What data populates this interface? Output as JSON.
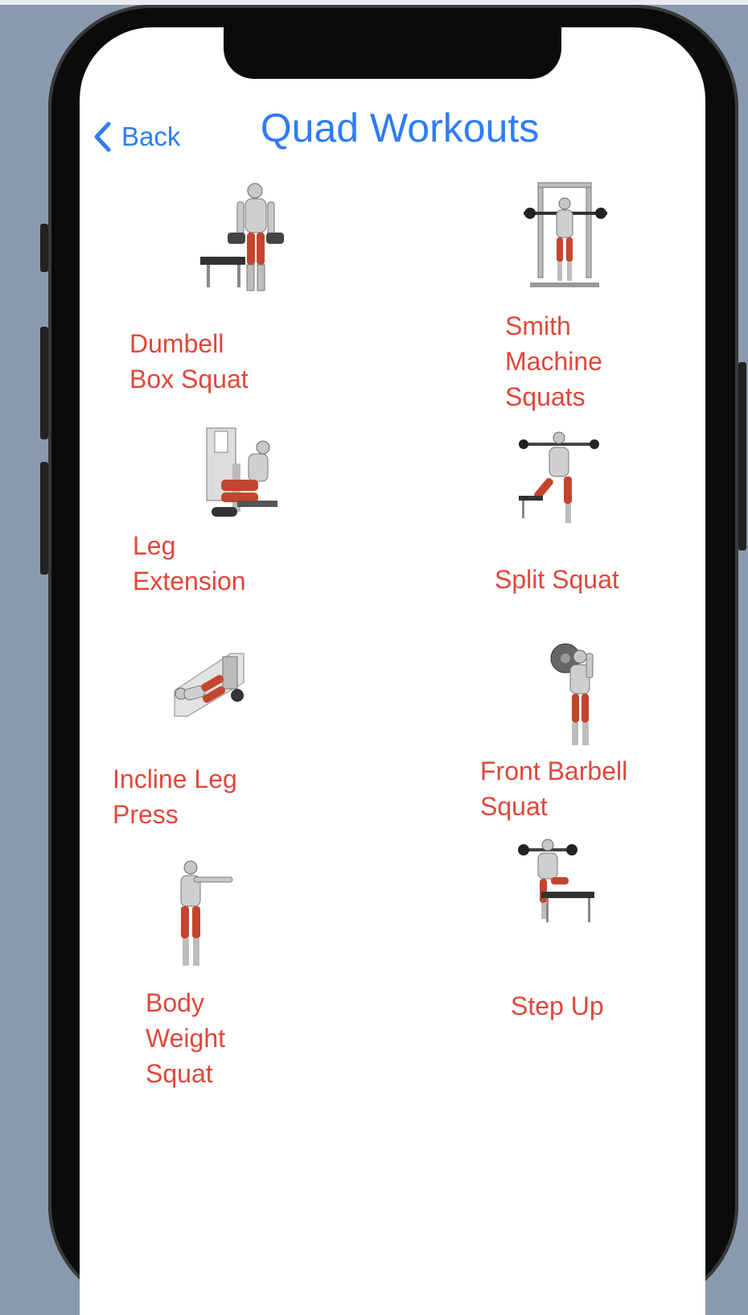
{
  "nav": {
    "back_label": "Back",
    "title": "Quad Workouts"
  },
  "colors": {
    "accent": "#2f7cf6",
    "label": "#e0473a",
    "muscle": "#c4452e",
    "bezel": "#0b0b0b",
    "background": "#8a9aae"
  },
  "exercises": [
    {
      "label": "Dumbell\nBox Squat",
      "icon": "dumbbell-squat-figure"
    },
    {
      "label": "Smith\nMachine\nSquats",
      "icon": "smith-machine-figure"
    },
    {
      "label": "Leg\nExtension",
      "icon": "leg-extension-figure"
    },
    {
      "label": "Split Squat",
      "icon": "split-squat-figure"
    },
    {
      "label": "Incline Leg\nPress",
      "icon": "leg-press-figure"
    },
    {
      "label": "Front Barbell\nSquat",
      "icon": "front-barbell-squat-figure"
    },
    {
      "label": "Body\nWeight\nSquat",
      "icon": "bodyweight-squat-figure"
    },
    {
      "label": "Step Up",
      "icon": "step-up-figure"
    }
  ]
}
